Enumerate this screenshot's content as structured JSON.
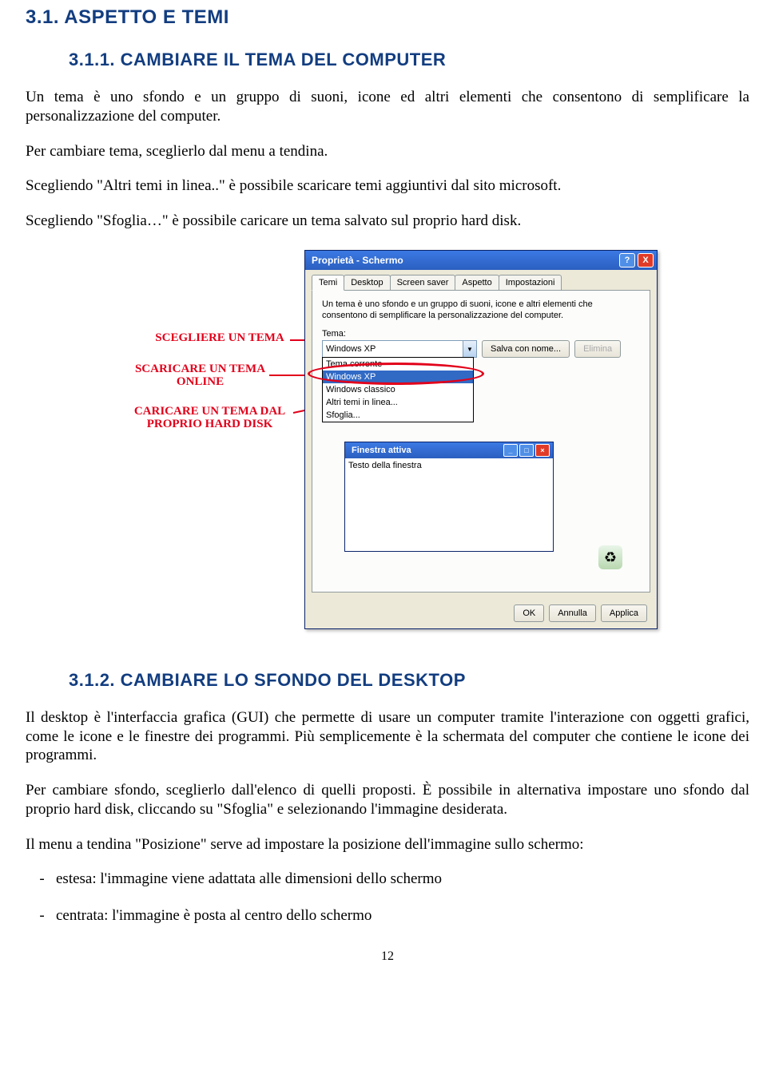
{
  "headings": {
    "h1": "3.1.  ASPETTO E TEMI",
    "h2a": "3.1.1.  CAMBIARE IL TEMA DEL COMPUTER",
    "h2b": "3.1.2.  CAMBIARE LO SFONDO DEL DESKTOP"
  },
  "paragraphs": {
    "p1": "Un tema è uno sfondo e un gruppo di suoni, icone ed altri elementi che consentono di semplificare la personalizzazione del computer.",
    "p2": "Per cambiare tema, sceglierlo dal menu a tendina.",
    "p3": "Scegliendo \"Altri temi in linea..\" è possibile scaricare temi aggiuntivi dal sito microsoft.",
    "p4": "Scegliendo \"Sfoglia…\" è possibile caricare un tema salvato sul proprio hard disk.",
    "p5": "Il desktop è l'interfaccia grafica (GUI) che permette di usare un computer tramite l'interazione con oggetti grafici, come le icone e le finestre dei programmi. Più semplicemente è la schermata del computer che contiene le icone dei programmi.",
    "p6": "Per cambiare sfondo, sceglierlo dall'elenco di quelli proposti. È possibile in alternativa impostare uno sfondo dal proprio hard disk, cliccando su \"Sfoglia\" e selezionando l'immagine desiderata.",
    "p7": "Il menu a tendina \"Posizione\" serve ad impostare la posizione dell'immagine sullo schermo:",
    "li1": "estesa: l'immagine viene adattata alle dimensioni dello schermo",
    "li2": "centrata: l'immagine è posta al centro dello schermo"
  },
  "annot": {
    "a1": "SCEGLIERE UN TEMA",
    "a2": "SCARICARE UN TEMA ONLINE",
    "a3": "CARICARE UN TEMA DAL PROPRIO HARD DISK"
  },
  "dialog": {
    "title": "Proprietà - Schermo",
    "help": "?",
    "close": "X",
    "tabs": [
      "Temi",
      "Desktop",
      "Screen saver",
      "Aspetto",
      "Impostazioni"
    ],
    "desc": "Un tema è uno sfondo e un gruppo di suoni, icone e altri elementi che consentono di semplificare la personalizzazione del computer.",
    "tema_label": "Tema:",
    "combo_value": "Windows XP",
    "btn_salva": "Salva con nome...",
    "btn_elimina": "Elimina",
    "dropdown": [
      "Tema corrente",
      "Windows XP",
      "Windows classico",
      "Altri temi in linea...",
      "Sfoglia..."
    ],
    "mini_title": "Finestra attiva",
    "mini_text": "Testo della finestra",
    "btn_ok": "OK",
    "btn_annulla": "Annulla",
    "btn_applica": "Applica"
  },
  "page_num": "12"
}
